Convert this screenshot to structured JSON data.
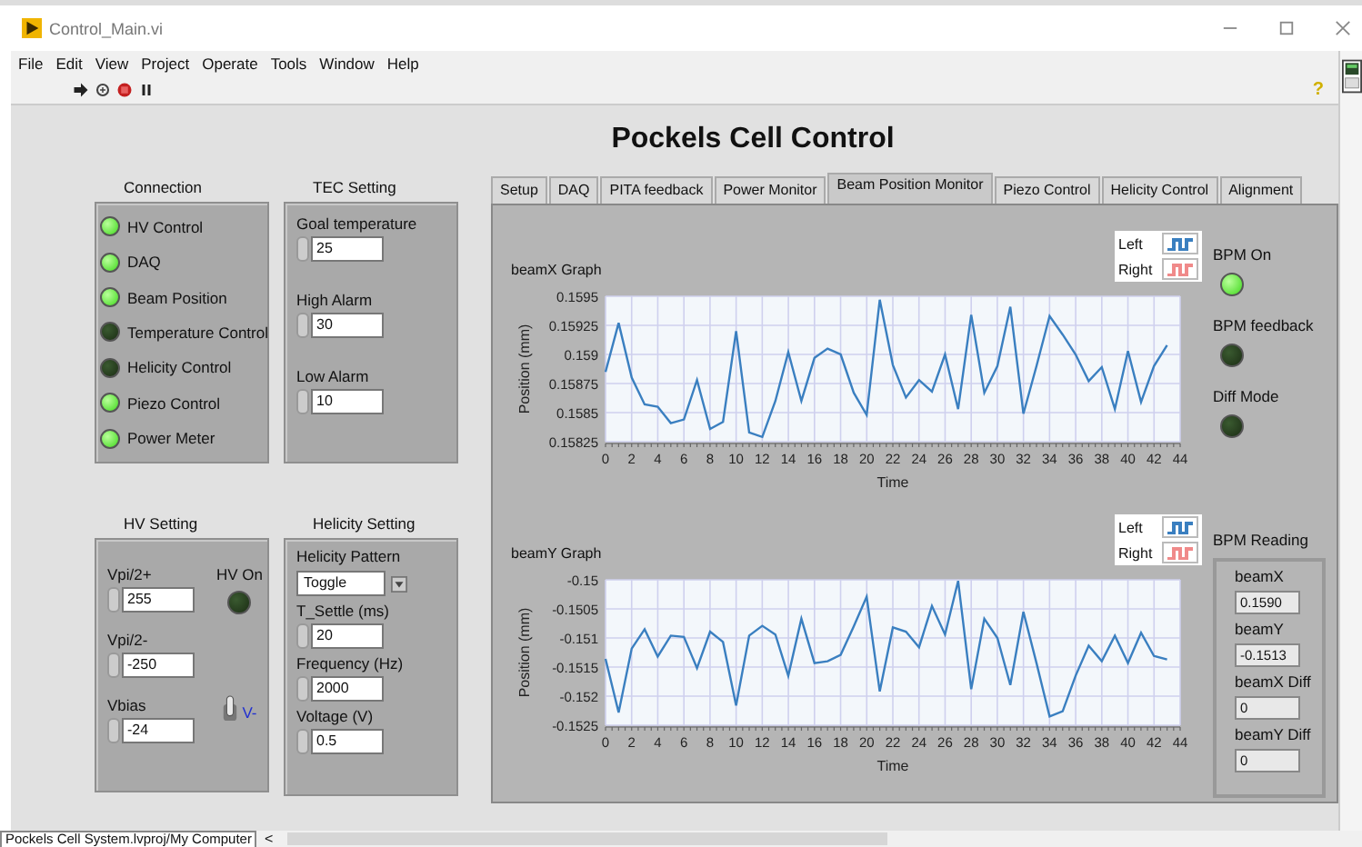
{
  "window": {
    "title": "Control_Main.vi"
  },
  "menu": [
    "File",
    "Edit",
    "View",
    "Project",
    "Operate",
    "Tools",
    "Window",
    "Help"
  ],
  "toolbar": {
    "help": "?"
  },
  "panel_title": "Pockels Cell Control",
  "connection": {
    "label": "Connection",
    "items": [
      {
        "label": "HV Control",
        "on": true
      },
      {
        "label": "DAQ",
        "on": true
      },
      {
        "label": "Beam Position",
        "on": true
      },
      {
        "label": "Temperature Control",
        "on": false
      },
      {
        "label": "Helicity Control",
        "on": false
      },
      {
        "label": "Piezo Control",
        "on": true
      },
      {
        "label": "Power Meter",
        "on": true
      }
    ]
  },
  "tec": {
    "label": "TEC Setting",
    "fields": [
      {
        "label": "Goal temperature",
        "value": "25"
      },
      {
        "label": "High Alarm",
        "value": "30"
      },
      {
        "label": "Low Alarm",
        "value": "10"
      }
    ]
  },
  "hv": {
    "label": "HV Setting",
    "fields": [
      {
        "label": "Vpi/2+",
        "value": "255"
      },
      {
        "label": "Vpi/2-",
        "value": "-250"
      },
      {
        "label": "Vbias",
        "value": "-24"
      }
    ],
    "indicator": {
      "label": "HV On",
      "on": false
    },
    "switch": {
      "label": "V-",
      "on": false
    }
  },
  "helicity": {
    "label": "Helicity Setting",
    "pattern": {
      "label": "Helicity Pattern",
      "value": "Toggle"
    },
    "fields": [
      {
        "label": "T_Settle (ms)",
        "value": "20"
      },
      {
        "label": "Frequency (Hz)",
        "value": "2000"
      },
      {
        "label": "Voltage (V)",
        "value": "0.5"
      }
    ]
  },
  "tabs": [
    {
      "label": "Setup",
      "selected": false
    },
    {
      "label": "DAQ",
      "selected": false
    },
    {
      "label": "PITA feedback",
      "selected": false
    },
    {
      "label": "Power Monitor",
      "selected": false
    },
    {
      "label": "Beam Position Monitor",
      "selected": true
    },
    {
      "label": "Piezo Control",
      "selected": false
    },
    {
      "label": "Helicity Control",
      "selected": false
    },
    {
      "label": "Alignment",
      "selected": false
    }
  ],
  "graphs": [
    {
      "title": "beamX Graph",
      "chart_data": {
        "type": "line",
        "grid": true,
        "xlabel": "Time",
        "ylabel": "Position (mm)",
        "xlim": [
          0,
          44
        ],
        "ylim": [
          0.15825,
          0.1595
        ],
        "xticks": [
          0,
          2,
          4,
          6,
          8,
          10,
          12,
          14,
          16,
          18,
          20,
          22,
          24,
          26,
          28,
          30,
          32,
          34,
          36,
          38,
          40,
          42,
          44
        ],
        "yticks": [
          {
            "value": 0.15825,
            "label": "0.15825"
          },
          {
            "value": 0.1585,
            "label": "0.1585"
          },
          {
            "value": 0.15875,
            "label": "0.15875"
          },
          {
            "value": 0.159,
            "label": "0.159"
          },
          {
            "value": 0.15925,
            "label": "0.15925"
          },
          {
            "value": 0.1595,
            "label": "0.1595"
          }
        ],
        "x": [
          0,
          1,
          2,
          3,
          4,
          5,
          6,
          7,
          8,
          9,
          10,
          11,
          12,
          13,
          14,
          15,
          16,
          17,
          18,
          19,
          20,
          21,
          22,
          23,
          24,
          25,
          26,
          27,
          28,
          29,
          30,
          31,
          32,
          33,
          34,
          35,
          36,
          37,
          38,
          39,
          40,
          41,
          42,
          43
        ],
        "series": [
          {
            "name": "Left",
            "color": "#3a7fc0",
            "values": [
              0.15885,
              0.15927,
              0.1588,
              0.15857,
              0.15855,
              0.15841,
              0.15844,
              0.15878,
              0.15836,
              0.15842,
              0.1592,
              0.15833,
              0.15829,
              0.1586,
              0.15902,
              0.1586,
              0.15897,
              0.15905,
              0.159,
              0.15867,
              0.15848,
              0.15947,
              0.15891,
              0.15863,
              0.15878,
              0.15868,
              0.159,
              0.15853,
              0.15934,
              0.15867,
              0.1589,
              0.15941,
              0.15849,
              0.1589,
              0.15933,
              0.15917,
              0.159,
              0.15877,
              0.15889,
              0.15853,
              0.15903,
              0.15859,
              0.1589,
              0.15908
            ]
          },
          {
            "name": "Right",
            "color": "#f08a8a",
            "values": [
              null,
              null,
              null,
              null,
              null,
              null,
              null,
              null,
              null,
              null,
              null,
              null,
              null,
              null,
              null,
              null,
              null,
              null,
              null,
              null,
              null,
              null,
              null,
              null,
              null,
              null,
              null,
              null,
              null,
              null,
              null,
              null,
              null,
              null,
              null,
              null,
              null,
              null,
              null,
              null,
              null,
              null,
              null,
              null
            ]
          }
        ]
      }
    },
    {
      "title": "beamY Graph",
      "chart_data": {
        "type": "line",
        "grid": true,
        "xlabel": "Time",
        "ylabel": "Position (mm)",
        "xlim": [
          0,
          44
        ],
        "ylim": [
          -0.1525,
          -0.15
        ],
        "xticks": [
          0,
          2,
          4,
          6,
          8,
          10,
          12,
          14,
          16,
          18,
          20,
          22,
          24,
          26,
          28,
          30,
          32,
          34,
          36,
          38,
          40,
          42,
          44
        ],
        "yticks": [
          {
            "value": -0.1525,
            "label": "-0.1525"
          },
          {
            "value": -0.152,
            "label": "-0.152"
          },
          {
            "value": -0.1515,
            "label": "-0.1515"
          },
          {
            "value": -0.151,
            "label": "-0.151"
          },
          {
            "value": -0.1505,
            "label": "-0.1505"
          },
          {
            "value": -0.15,
            "label": "-0.15"
          }
        ],
        "x": [
          0,
          1,
          2,
          3,
          4,
          5,
          6,
          7,
          8,
          9,
          10,
          11,
          12,
          13,
          14,
          15,
          16,
          17,
          18,
          19,
          20,
          21,
          22,
          23,
          24,
          25,
          26,
          27,
          28,
          29,
          30,
          31,
          32,
          33,
          34,
          35,
          36,
          37,
          38,
          39,
          40,
          41,
          42,
          43
        ],
        "series": [
          {
            "name": "Left",
            "color": "#3a7fc0",
            "values": [
              -0.15136,
              -0.15228,
              -0.15118,
              -0.15085,
              -0.15132,
              -0.15096,
              -0.15098,
              -0.15152,
              -0.15089,
              -0.15107,
              -0.15216,
              -0.15096,
              -0.15079,
              -0.15094,
              -0.15165,
              -0.15067,
              -0.15143,
              -0.1514,
              -0.15129,
              -0.1508,
              -0.15029,
              -0.15192,
              -0.15082,
              -0.15089,
              -0.15116,
              -0.15045,
              -0.15094,
              -0.15002,
              -0.15188,
              -0.15067,
              -0.151,
              -0.15181,
              -0.15055,
              -0.15143,
              -0.15235,
              -0.15226,
              -0.15165,
              -0.15113,
              -0.1514,
              -0.15096,
              -0.15143,
              -0.15091,
              -0.15131,
              -0.15137
            ]
          },
          {
            "name": "Right",
            "color": "#f08a8a",
            "values": [
              null,
              null,
              null,
              null,
              null,
              null,
              null,
              null,
              null,
              null,
              null,
              null,
              null,
              null,
              null,
              null,
              null,
              null,
              null,
              null,
              null,
              null,
              null,
              null,
              null,
              null,
              null,
              null,
              null,
              null,
              null,
              null,
              null,
              null,
              null,
              null,
              null,
              null,
              null,
              null,
              null,
              null,
              null,
              null
            ]
          }
        ]
      }
    }
  ],
  "bpm": {
    "indicators": [
      {
        "label": "BPM On",
        "on": true
      },
      {
        "label": "BPM feedback",
        "on": false
      },
      {
        "label": "Diff Mode",
        "on": false
      }
    ],
    "reading": {
      "label": "BPM Reading",
      "fields": [
        {
          "label": "beamX",
          "value": "0.1590"
        },
        {
          "label": "beamY",
          "value": "-0.1513"
        },
        {
          "label": "beamX Diff",
          "value": "0"
        },
        {
          "label": "beamY Diff",
          "value": "0"
        }
      ]
    }
  },
  "status_bar": {
    "path": "Pockels Cell System.lvproj/My Computer",
    "arrow": "<"
  }
}
